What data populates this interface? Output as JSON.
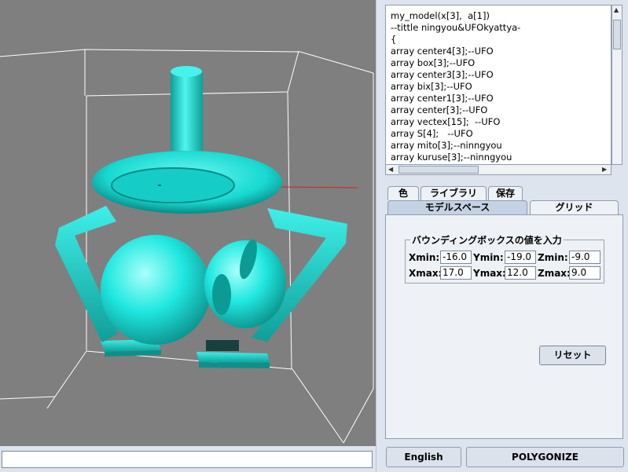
{
  "viewport": {
    "colors": {
      "background": "#7f7f7f",
      "model": "#1fe8e0",
      "box_edges": "#ffffff",
      "axis": "#d32222"
    }
  },
  "code": {
    "lines": [
      "my_model(x[3],  a[1])",
      "--tittle ningyou&UFOkyattya-",
      "{",
      "array center4[3];--UFO",
      "array box[3];--UFO",
      "array center3[3];--UFO",
      "array bix[3];--UFO",
      "array center1[3];--UFO",
      "array center[3];--UFO",
      "array vectex[15];  --UFO",
      "array S[4];   --UFO",
      "array mito[3];--ninngyou",
      "array kuruse[3];--ninngyou"
    ]
  },
  "tabs": {
    "top": [
      "色",
      "ライブラリ",
      "保存"
    ],
    "bottom": [
      "モデルスペース",
      "グリッド"
    ],
    "active": "モデルスペース"
  },
  "bounding_box": {
    "legend": "バウンディングボックスの値を入力",
    "xmin_label": "Xmin:",
    "xmin": "-16.0",
    "ymin_label": "Ymin:",
    "ymin": "-19.0",
    "zmin_label": "Zmin:",
    "zmin": "-9.0",
    "xmax_label": "Xmax:",
    "xmax": "17.0",
    "ymax_label": "Ymax:",
    "ymax": "12.0",
    "zmax_label": "Zmax:",
    "zmax": "9.0"
  },
  "reset_label": "リセット",
  "english_label": "English",
  "polygonize_label": "POLYGONIZE",
  "command_input": {
    "value": ""
  }
}
